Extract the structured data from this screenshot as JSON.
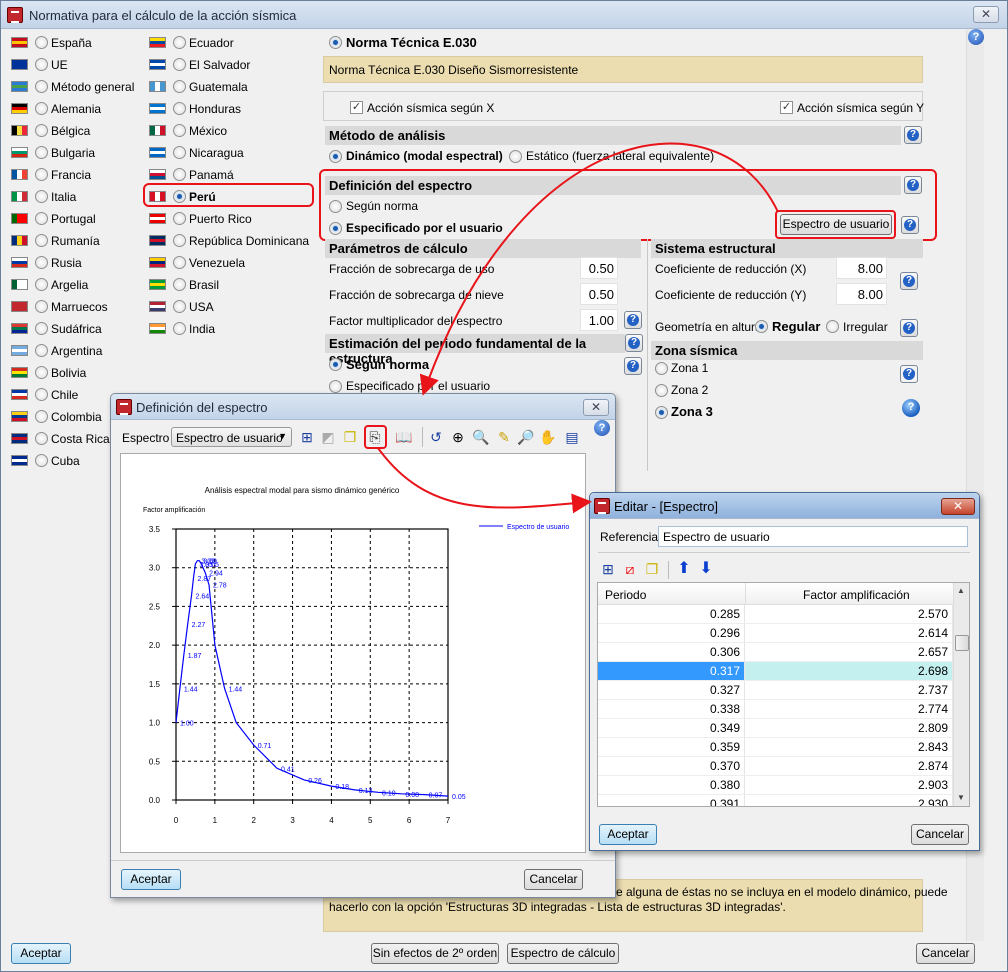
{
  "window": {
    "title": "Normativa para el cálculo de la acción sísmica"
  },
  "countries_col1": [
    {
      "name": "España",
      "flag": [
        "#c60b1e",
        "#ffc400",
        "#c60b1e"
      ],
      "selected": false
    },
    {
      "name": "UE",
      "flag": [
        "#003399",
        "#003399",
        "#003399"
      ],
      "selected": false
    },
    {
      "name": "Método general",
      "flag": [
        "#2a7bd6",
        "#4aa04a",
        "#2a7bd6"
      ],
      "selected": false
    },
    {
      "name": "Alemania",
      "flag": [
        "#000000",
        "#dd0000",
        "#ffce00"
      ],
      "selected": false
    },
    {
      "name": "Bélgica",
      "flag": [
        "#000000",
        "#fae042",
        "#ed2939"
      ],
      "vertical": true,
      "selected": false
    },
    {
      "name": "Bulgaria",
      "flag": [
        "#ffffff",
        "#00966e",
        "#d62612"
      ],
      "selected": false
    },
    {
      "name": "Francia",
      "flag": [
        "#0055a4",
        "#ffffff",
        "#ef4135"
      ],
      "vertical": true,
      "selected": false
    },
    {
      "name": "Italia",
      "flag": [
        "#009246",
        "#ffffff",
        "#ce2b37"
      ],
      "vertical": true,
      "selected": false
    },
    {
      "name": "Portugal",
      "flag": [
        "#006600",
        "#ff0000",
        "#ff0000"
      ],
      "vertical": true,
      "selected": false
    },
    {
      "name": "Rumanía",
      "flag": [
        "#002b7f",
        "#fcd116",
        "#ce1126"
      ],
      "vertical": true,
      "selected": false
    },
    {
      "name": "Rusia",
      "flag": [
        "#ffffff",
        "#0039a6",
        "#d52b1e"
      ],
      "selected": false
    },
    {
      "name": "Argelia",
      "flag": [
        "#006233",
        "#ffffff",
        "#ffffff"
      ],
      "vertical": true,
      "selected": false
    },
    {
      "name": "Marruecos",
      "flag": [
        "#c1272d",
        "#c1272d",
        "#c1272d"
      ],
      "selected": false
    },
    {
      "name": "Sudáfrica",
      "flag": [
        "#de3831",
        "#007a4d",
        "#002395"
      ],
      "selected": false
    },
    {
      "name": "Argentina",
      "flag": [
        "#74acdf",
        "#ffffff",
        "#74acdf"
      ],
      "selected": false
    },
    {
      "name": "Bolivia",
      "flag": [
        "#d52b1e",
        "#f9e300",
        "#007934"
      ],
      "selected": false
    },
    {
      "name": "Chile",
      "flag": [
        "#0039a6",
        "#ffffff",
        "#d52b1e"
      ],
      "selected": false
    },
    {
      "name": "Colombia",
      "flag": [
        "#fcd116",
        "#003893",
        "#ce1126"
      ],
      "selected": false
    },
    {
      "name": "Costa Rica",
      "flag": [
        "#002b7f",
        "#ce1126",
        "#002b7f"
      ],
      "selected": false
    },
    {
      "name": "Cuba",
      "flag": [
        "#002a8f",
        "#ffffff",
        "#002a8f"
      ],
      "selected": false
    }
  ],
  "countries_col2": [
    {
      "name": "Ecuador",
      "flag": [
        "#ffdd00",
        "#034ea2",
        "#ed1c24"
      ],
      "selected": false
    },
    {
      "name": "El Salvador",
      "flag": [
        "#0047ab",
        "#ffffff",
        "#0047ab"
      ],
      "selected": false
    },
    {
      "name": "Guatemala",
      "flag": [
        "#4997d0",
        "#ffffff",
        "#4997d0"
      ],
      "vertical": true,
      "selected": false
    },
    {
      "name": "Honduras",
      "flag": [
        "#0073cf",
        "#ffffff",
        "#0073cf"
      ],
      "selected": false
    },
    {
      "name": "México",
      "flag": [
        "#006847",
        "#ffffff",
        "#ce1126"
      ],
      "vertical": true,
      "selected": false
    },
    {
      "name": "Nicaragua",
      "flag": [
        "#0067c6",
        "#ffffff",
        "#0067c6"
      ],
      "selected": false
    },
    {
      "name": "Panamá",
      "flag": [
        "#ffffff",
        "#d21034",
        "#005293"
      ],
      "selected": false
    },
    {
      "name": "Perú",
      "flag": [
        "#d91023",
        "#ffffff",
        "#d91023"
      ],
      "vertical": true,
      "selected": true
    },
    {
      "name": "Puerto Rico",
      "flag": [
        "#ed0000",
        "#ffffff",
        "#ed0000"
      ],
      "selected": false
    },
    {
      "name": "República Dominicana",
      "flag": [
        "#002d62",
        "#ce1126",
        "#002d62"
      ],
      "selected": false
    },
    {
      "name": "Venezuela",
      "flag": [
        "#ffcc00",
        "#00247d",
        "#cf142b"
      ],
      "selected": false
    },
    {
      "name": "Brasil",
      "flag": [
        "#009c3b",
        "#ffdf00",
        "#009c3b"
      ],
      "selected": false
    },
    {
      "name": "USA",
      "flag": [
        "#b22234",
        "#ffffff",
        "#3c3b6e"
      ],
      "selected": false
    },
    {
      "name": "India",
      "flag": [
        "#ff9933",
        "#ffffff",
        "#138808"
      ],
      "selected": false
    }
  ],
  "norma": {
    "label": "Norma Técnica E.030",
    "description": "Norma Técnica E.030 Diseño Sismorresistente"
  },
  "accion": {
    "x_label": "Acción sísmica según X",
    "x_checked": true,
    "y_label": "Acción sísmica según Y",
    "y_checked": true
  },
  "metodo": {
    "header": "Método de análisis",
    "dinamico": "Dinámico (modal espectral)",
    "estatico": "Estático (fuerza lateral equivalente)",
    "selected": "dinamico"
  },
  "espectro": {
    "header": "Definición del espectro",
    "segun_norma": "Según norma",
    "usuario": "Especificado por el usuario",
    "selected": "usuario",
    "button": "Espectro de usuario"
  },
  "parametros": {
    "header": "Parámetros de cálculo",
    "rows": [
      {
        "label": "Fracción de sobrecarga de uso",
        "value": "0.50"
      },
      {
        "label": "Fracción de sobrecarga de nieve",
        "value": "0.50"
      },
      {
        "label": "Factor multiplicador del espectro",
        "value": "1.00"
      }
    ]
  },
  "periodo": {
    "header": "Estimación del periodo fundamental de la estructura",
    "segun_norma": "Según norma",
    "usuario": "Especificado por el usuario",
    "selected": "segun_norma"
  },
  "sistema": {
    "header": "Sistema estructural",
    "rows": [
      {
        "label": "Coeficiente de reducción (X)",
        "value": "8.00"
      },
      {
        "label": "Coeficiente de reducción (Y)",
        "value": "8.00"
      }
    ],
    "geometria_label": "Geometría en altura",
    "regular": "Regular",
    "irregular": "Irregular",
    "geometria_selected": "regular"
  },
  "zona": {
    "header": "Zona sísmica",
    "options": [
      "Zona 1",
      "Zona 2",
      "Zona 3"
    ],
    "selected": 2
  },
  "note": {
    "text_line1": "e alguna de éstas no se incluya en el modelo dinámico, puede",
    "text_line2": "hacerlo con la opción 'Estructuras 3D integradas - Lista de estructuras 3D integradas'."
  },
  "footer": {
    "aceptar": "Aceptar",
    "sin_efectos": "Sin efectos de 2º orden",
    "espectro_calculo": "Espectro de cálculo",
    "cancelar": "Cancelar"
  },
  "dialog_espectro": {
    "title": "Definición del espectro",
    "espectro_label": "Espectro",
    "espectro_value": "Espectro de usuario",
    "aceptar": "Aceptar",
    "cancelar": "Cancelar"
  },
  "chart_data": {
    "type": "line",
    "title": "Análisis espectral modal para sismo dinámico genérico",
    "ylabel": "Factor amplificación",
    "xlabel": "",
    "xlim": [
      0,
      7
    ],
    "ylim": [
      0,
      3.5
    ],
    "xticks": [
      "0",
      "1",
      "2",
      "3",
      "4",
      "5",
      "6",
      "7"
    ],
    "yticks": [
      "0.0",
      "0.5",
      "1.0",
      "1.5",
      "2.0",
      "2.5",
      "3.0",
      "3.5"
    ],
    "grid": true,
    "legend_position": "top-right",
    "series": [
      {
        "name": "Espectro de usuario",
        "color": "#0000ff",
        "x": [
          0,
          0.1,
          0.2,
          0.3,
          0.4,
          0.45,
          0.5,
          0.55,
          0.6,
          0.65,
          0.75,
          0.85,
          1.0,
          1.25,
          1.55,
          2.0,
          2.6,
          3.3,
          4.0,
          4.6,
          5.2,
          5.8,
          6.4,
          7.0
        ],
        "y": [
          1.0,
          1.44,
          1.87,
          2.27,
          2.64,
          2.87,
          3.05,
          3.09,
          3.09,
          3.05,
          2.94,
          2.78,
          2.0,
          1.44,
          1.0,
          0.71,
          0.41,
          0.26,
          0.18,
          0.13,
          0.1,
          0.08,
          0.07,
          0.05
        ],
        "labels": [
          "1.00",
          "1.44",
          "1.87",
          "2.27",
          "2.64",
          "2.87",
          "3.05",
          "3.09",
          "3.09",
          "3.05",
          "2.94",
          "2.78",
          "",
          "1.44",
          "",
          "0.71",
          "0.41",
          "0.26",
          "0.18",
          "0.13",
          "0.10",
          "0.08",
          "0.07",
          "0.05"
        ]
      }
    ]
  },
  "dialog_editar": {
    "title": "Editar - [Espectro]",
    "referencia_label": "Referencia",
    "referencia_value": "Espectro de usuario",
    "columns": [
      "Periodo",
      "Factor amplificación"
    ],
    "rows": [
      [
        "0.285",
        "2.570"
      ],
      [
        "0.296",
        "2.614"
      ],
      [
        "0.306",
        "2.657"
      ],
      [
        "0.317",
        "2.698"
      ],
      [
        "0.327",
        "2.737"
      ],
      [
        "0.338",
        "2.774"
      ],
      [
        "0.349",
        "2.809"
      ],
      [
        "0.359",
        "2.843"
      ],
      [
        "0.370",
        "2.874"
      ],
      [
        "0.380",
        "2.903"
      ],
      [
        "0.391",
        "2.930"
      ]
    ],
    "selected_row": 3,
    "aceptar": "Aceptar",
    "cancelar": "Cancelar"
  },
  "colors": {
    "highlight": "#e8141a",
    "selection": "#3399ff",
    "selection_row": "#c4f0f0",
    "beige": "#ebddb0"
  }
}
